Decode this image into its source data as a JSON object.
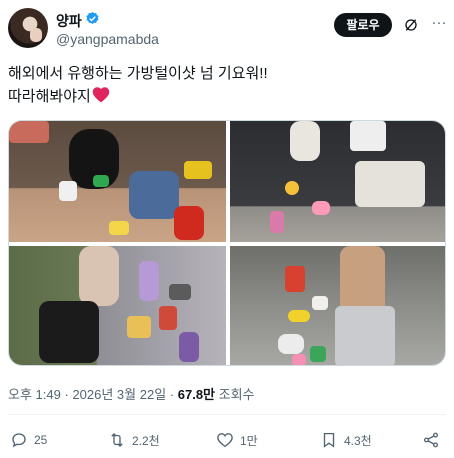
{
  "author": {
    "display_name": "양파",
    "handle": "@yangpamabda",
    "verified": true
  },
  "header": {
    "follow_label": "팔로우",
    "grok_icon": "grok-icon",
    "more_icon": "more-icon"
  },
  "tweet": {
    "line1": "해외에서 유행하는 가방털이샷 넘 기요워!!",
    "line2": "따라해봐야지",
    "emoji": "heart"
  },
  "media": {
    "photo_count": 4
  },
  "meta": {
    "time": "오후 1:49",
    "separator": "·",
    "date": "2026년 3월 22일",
    "views_count": "67.8만",
    "views_label": "조회수"
  },
  "actions": {
    "reply_count": "25",
    "retweet_count": "2.2천",
    "like_count": "1만",
    "bookmark_count": "4.3천"
  },
  "colors": {
    "accent_verified": "#1d9bf0",
    "heart_emoji": "#e0245e",
    "text_secondary": "#536471"
  }
}
